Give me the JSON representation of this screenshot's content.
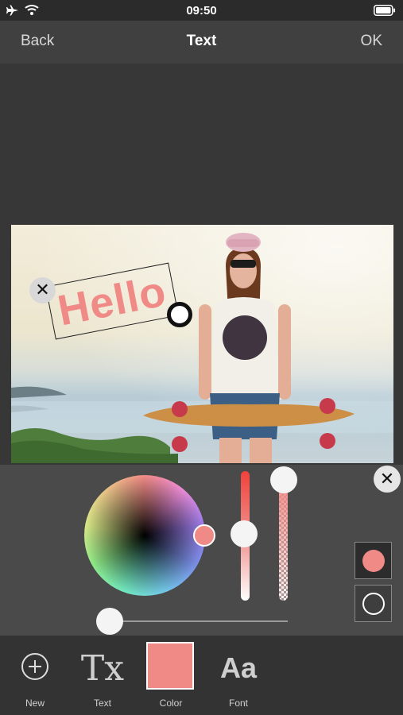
{
  "status": {
    "time": "09:50"
  },
  "nav": {
    "back": "Back",
    "title": "Text",
    "ok": "OK"
  },
  "canvas": {
    "text_value": "Hello",
    "text_color": "#f08a86"
  },
  "color_panel": {
    "selected_color": "#f08a86",
    "brightness_level": 0.5,
    "opacity_level": 1.0,
    "size_level": 0.0,
    "swatches": [
      "fill-color",
      "outline-color"
    ]
  },
  "toolbar": {
    "new": "New",
    "text": "Text",
    "color": "Color",
    "font": "Font",
    "text_icon": "Tx",
    "font_icon": "Aa"
  },
  "icons": {
    "status_left": [
      "airplane-icon",
      "wifi-icon"
    ],
    "status_right": "battery-icon",
    "close": "close-icon",
    "rotate": "rotate-handle-icon",
    "new": "plus-circle-icon"
  }
}
